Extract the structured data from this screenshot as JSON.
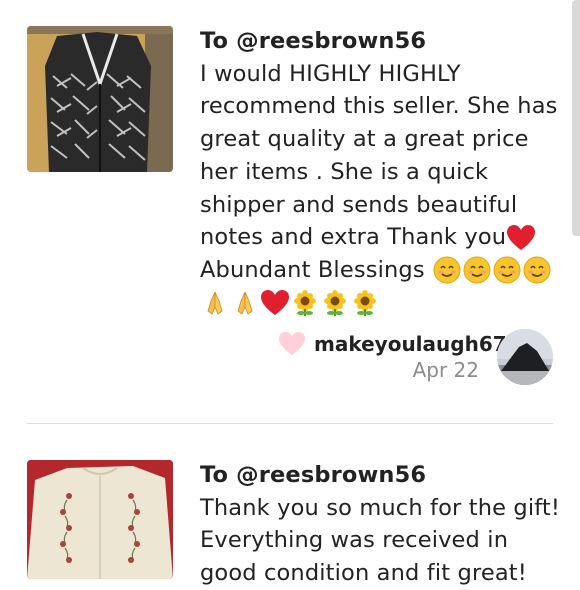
{
  "comments": [
    {
      "to": "To @reesbrown56",
      "lines": [
        "I would HIGHLY HIGHLY",
        "recommend this seller. She has",
        "great quality at a great price",
        "her items . She is a quick",
        "shipper and sends beautiful",
        "notes and extra Thank you",
        "Abundant Blessings "
      ],
      "emoji_names": [
        "red-heart",
        "smiling-face",
        "folded-hands",
        "sunflower"
      ],
      "author": "makeyoulaugh67",
      "date": "Apr 22"
    },
    {
      "to": "To @reesbrown56",
      "lines": [
        "Thank you so much for the gift!",
        "Everything was received in",
        "good condition and fit great!"
      ]
    }
  ],
  "colors": {
    "like_heart": "#ffd0d8",
    "red_heart": "#e0202e",
    "divider": "#dddddd",
    "date_text": "#8c8c8c"
  }
}
